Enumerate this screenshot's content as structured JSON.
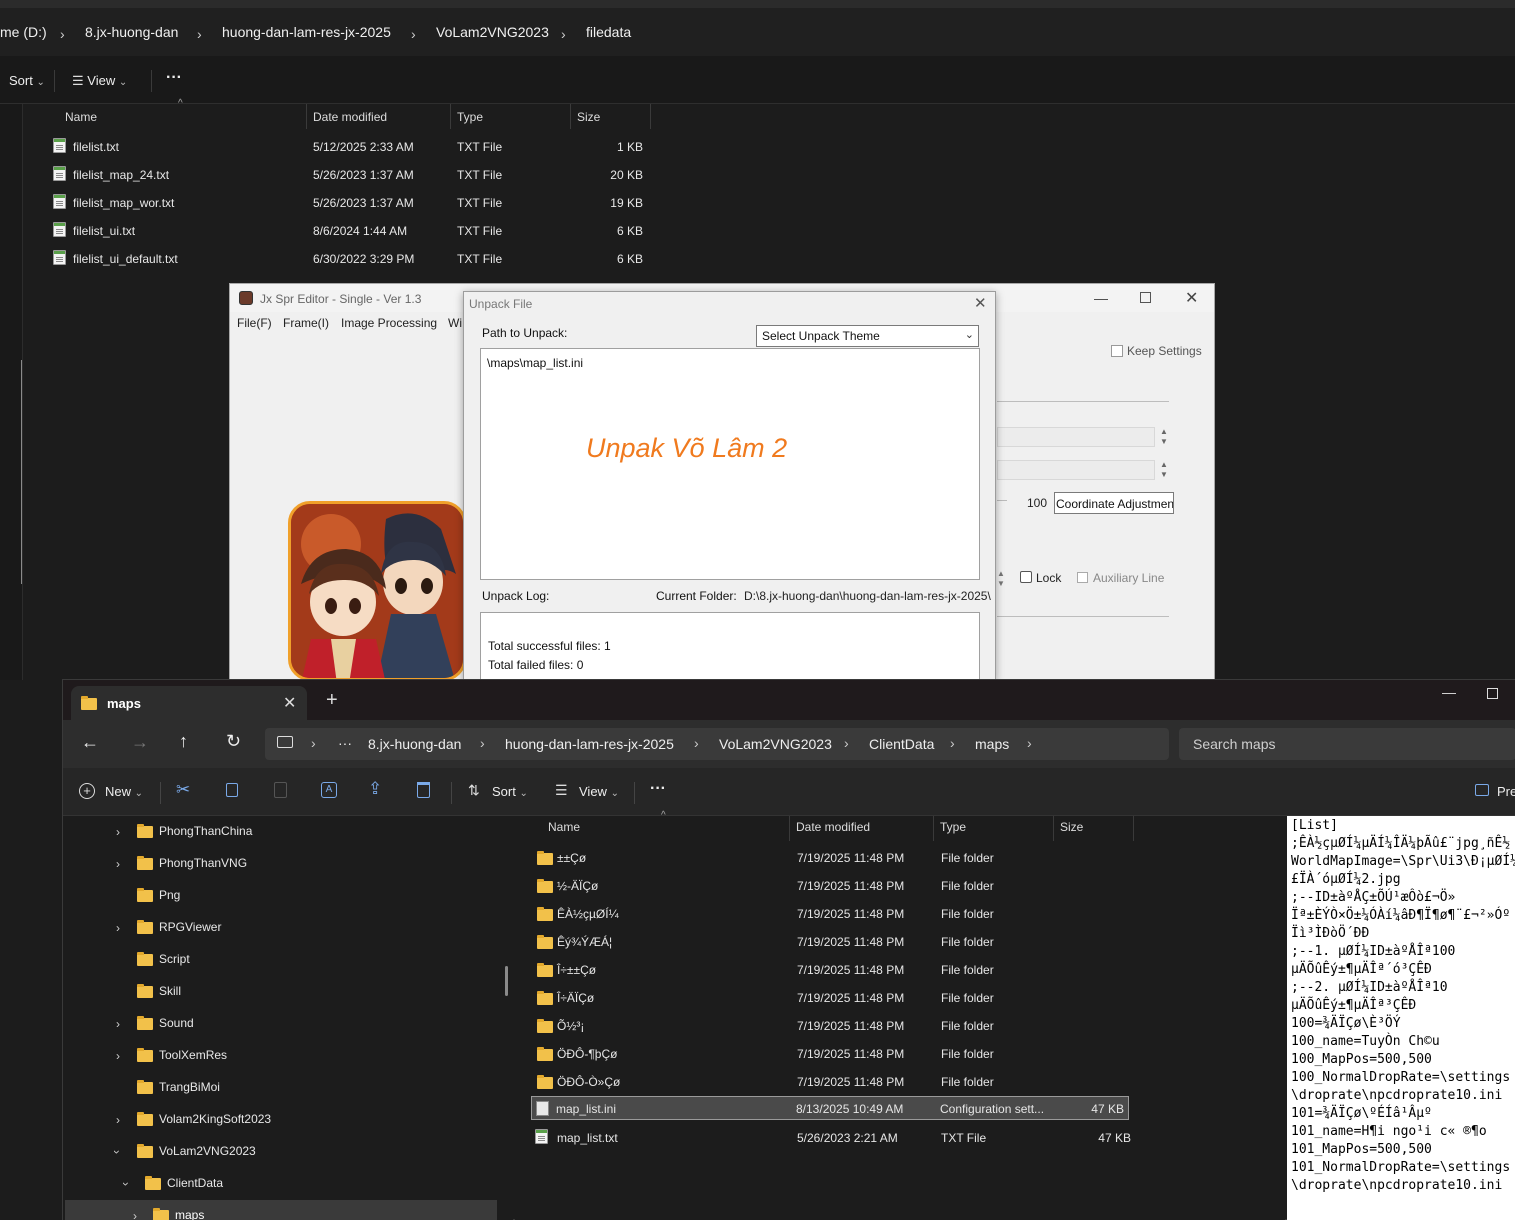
{
  "top_explorer": {
    "breadcrumb": [
      "me (D:)",
      "8.jx-huong-dan",
      "huong-dan-lam-res-jx-2025",
      "VoLam2VNG2023",
      "filedata"
    ],
    "toolbar": {
      "sort": "Sort",
      "view": "View",
      "more": "···"
    },
    "columns": {
      "name": "Name",
      "date": "Date modified",
      "type": "Type",
      "size": "Size"
    },
    "files": [
      {
        "name": "filelist.txt",
        "date": "5/12/2025 2:33 AM",
        "type": "TXT File",
        "size": "1 KB"
      },
      {
        "name": "filelist_map_24.txt",
        "date": "5/26/2023 1:37 AM",
        "type": "TXT File",
        "size": "20 KB"
      },
      {
        "name": "filelist_map_wor.txt",
        "date": "5/26/2023 1:37 AM",
        "type": "TXT File",
        "size": "19 KB"
      },
      {
        "name": "filelist_ui.txt",
        "date": "8/6/2024 1:44 AM",
        "type": "TXT File",
        "size": "6 KB"
      },
      {
        "name": "filelist_ui_default.txt",
        "date": "6/30/2022 3:29 PM",
        "type": "TXT File",
        "size": "6 KB"
      }
    ]
  },
  "spr_editor": {
    "title": "Jx Spr Editor - Single - Ver 1.3",
    "menu": [
      "File(F)",
      "Frame(I)",
      "Image Processing",
      "Wi"
    ],
    "keep_settings": "Keep Settings",
    "value_100": "100",
    "coord_button": "Coordinate Adjustmen",
    "lock": "Lock",
    "aux_line": "Auxiliary Line"
  },
  "unpack": {
    "title": "Unpack File",
    "path_label": "Path to Unpack:",
    "theme_select": "Select Unpack Theme",
    "path_text": "\\maps\\map_list.ini",
    "watermark": "Unpak Võ Lâm 2",
    "log_label": "Unpack Log:",
    "current_folder_label": "Current Folder:",
    "current_folder": "D:\\8.jx-huong-dan\\huong-dan-lam-res-jx-2025\\",
    "log_lines": [
      "Total successful files: 1",
      "Total failed files: 0"
    ],
    "accent_color": "#f07a1e"
  },
  "bottom_explorer": {
    "tab_title": "maps",
    "breadcrumb": [
      "···",
      "8.jx-huong-dan",
      "huong-dan-lam-res-jx-2025",
      "VoLam2VNG2023",
      "ClientData",
      "maps"
    ],
    "search_placeholder": "Search maps",
    "toolbar": {
      "new": "New",
      "sort": "Sort",
      "view": "View",
      "more": "···",
      "preview": "Pre"
    },
    "nav": [
      {
        "label": "PhongThanChina",
        "expand": true
      },
      {
        "label": "PhongThanVNG",
        "expand": true
      },
      {
        "label": "Png",
        "expand": false
      },
      {
        "label": "RPGViewer",
        "expand": true
      },
      {
        "label": "Script",
        "expand": false
      },
      {
        "label": "Skill",
        "expand": false
      },
      {
        "label": "Sound",
        "expand": true
      },
      {
        "label": "ToolXemRes",
        "expand": true
      },
      {
        "label": "TrangBiMoi",
        "expand": false
      },
      {
        "label": "Volam2KingSoft2023",
        "expand": true
      },
      {
        "label": "VoLam2VNG2023",
        "expand": true
      },
      {
        "label": "ClientData",
        "expand": true
      },
      {
        "label": "maps",
        "expand": true
      }
    ],
    "columns": {
      "name": "Name",
      "date": "Date modified",
      "type": "Type",
      "size": "Size"
    },
    "rows": [
      {
        "name": "±±Çø",
        "date": "7/19/2025 11:48 PM",
        "type": "File folder",
        "size": "",
        "kind": "folder"
      },
      {
        "name": "½-ÄÏÇø",
        "date": "7/19/2025 11:48 PM",
        "type": "File folder",
        "size": "",
        "kind": "folder"
      },
      {
        "name": "ÊÀ½çµØÍ¼",
        "date": "7/19/2025 11:48 PM",
        "type": "File folder",
        "size": "",
        "kind": "folder"
      },
      {
        "name": "Êý¾ÝÆÁ¦",
        "date": "7/19/2025 11:48 PM",
        "type": "File folder",
        "size": "",
        "kind": "folder"
      },
      {
        "name": "Î÷±±Çø",
        "date": "7/19/2025 11:48 PM",
        "type": "File folder",
        "size": "",
        "kind": "folder"
      },
      {
        "name": "Î÷ÄÏÇø",
        "date": "7/19/2025 11:48 PM",
        "type": "File folder",
        "size": "",
        "kind": "folder"
      },
      {
        "name": "Õ½³¡",
        "date": "7/19/2025 11:48 PM",
        "type": "File folder",
        "size": "",
        "kind": "folder"
      },
      {
        "name": "ÖÐÔ-¶þÇø",
        "date": "7/19/2025 11:48 PM",
        "type": "File folder",
        "size": "",
        "kind": "folder"
      },
      {
        "name": "ÖÐÔ-Ò»Çø",
        "date": "7/19/2025 11:48 PM",
        "type": "File folder",
        "size": "",
        "kind": "folder"
      },
      {
        "name": "map_list.ini",
        "date": "8/13/2025 10:49 AM",
        "type": "Configuration sett...",
        "size": "47 KB",
        "kind": "ini"
      },
      {
        "name": "map_list.txt",
        "date": "5/26/2023 2:21 AM",
        "type": "TXT File",
        "size": "47 KB",
        "kind": "txt"
      }
    ],
    "preview_lines": [
      "[List]",
      ";ÊÀ½çµØÍ¼µÄÍ¼ÎÄ¼þÃû£¨jpg¸ñÊ½",
      "WorldMapImage=\\Spr\\Ui3\\Ð¡µØÍ¼",
      "£ÏÀ´óµØÍ¼2.jpg",
      "",
      ";--ID±àºÅÇ±ÕÚ¹æÔò£¬Ö»",
      "Ïª±ÈÝÒ×Ö±¼ÓÀí¼âÐ¶Ï¶ø¶¨£¬²»Óº",
      "Ïì³ÌÐòÖ´ÐÐ",
      ";--1. µØÍ¼ID±àºÅÎª100",
      "µÄÕûÊý±¶µÄÎª´ó³ÇÊÐ",
      ";--2. µØÍ¼ID±àºÅÎª10",
      "µÄÕûÊý±¶µÄÎª³ÇÊÐ",
      "",
      "100=¾ÄÏÇø\\È³ÖÝ",
      "100_name=TuyÒn Ch©u",
      "100_MapPos=500,500",
      "100_NormalDropRate=\\settings",
      "\\droprate\\npcdroprate10.ini",
      "101=¾ÄÏÇø\\ºÉÍâ¹Âµº",
      "101_name=H¶i ngo¹i c« ®¶o",
      "101_MapPos=500,500",
      "101_NormalDropRate=\\settings",
      "\\droprate\\npcdroprate10.ini"
    ],
    "selected_row": 9
  }
}
